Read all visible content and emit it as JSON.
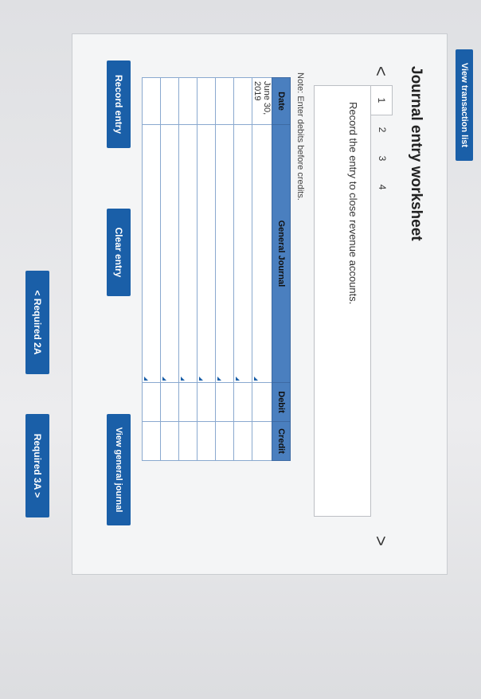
{
  "toolbar": {
    "view_transactions_label": "View transaction list"
  },
  "worksheet": {
    "title": "Journal entry worksheet",
    "prev_arrow": "<",
    "next_arrow": ">",
    "tabs": [
      {
        "label": "1",
        "active": true
      },
      {
        "label": "2",
        "active": false
      },
      {
        "label": "3",
        "active": false
      },
      {
        "label": "4",
        "active": false
      }
    ],
    "instruction": "Record the entry to close revenue accounts.",
    "note": "Note: Enter debits before credits.",
    "table": {
      "headers": {
        "date": "Date",
        "account": "General Journal",
        "debit": "Debit",
        "credit": "Credit"
      },
      "rows": [
        {
          "date": "June 30, 2019",
          "account": "",
          "debit": "",
          "credit": ""
        },
        {
          "date": "",
          "account": "",
          "debit": "",
          "credit": ""
        },
        {
          "date": "",
          "account": "",
          "debit": "",
          "credit": ""
        },
        {
          "date": "",
          "account": "",
          "debit": "",
          "credit": ""
        },
        {
          "date": "",
          "account": "",
          "debit": "",
          "credit": ""
        },
        {
          "date": "",
          "account": "",
          "debit": "",
          "credit": ""
        },
        {
          "date": "",
          "account": "",
          "debit": "",
          "credit": ""
        }
      ]
    },
    "buttons": {
      "record": "Record entry",
      "clear": "Clear entry",
      "view_journal": "View general journal"
    }
  },
  "navigation": {
    "prev_label": "< Required 2A",
    "next_label": "Required 3A >"
  },
  "colors": {
    "accent": "#1a5fa8",
    "header": "#4a7fbf"
  }
}
